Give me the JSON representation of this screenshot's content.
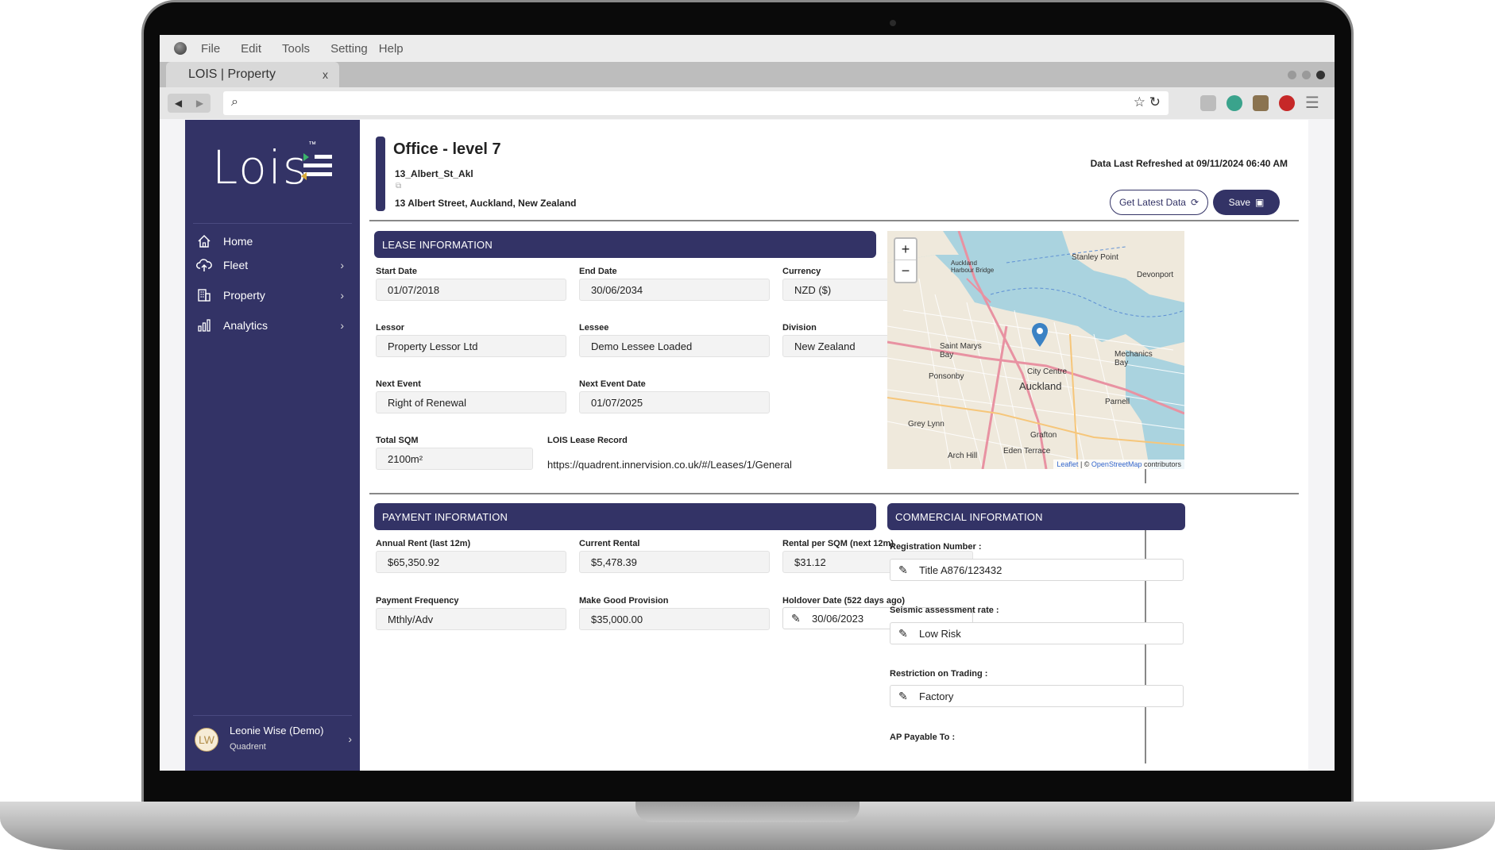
{
  "menu": [
    "File",
    "Edit",
    "Tools",
    "Setting",
    "Help"
  ],
  "tab": {
    "title": "LOIS | Property",
    "close": "x"
  },
  "sidebar": {
    "logo": "Lois",
    "logo_tm": "™",
    "items": [
      {
        "label": "Home",
        "icon": "home-icon"
      },
      {
        "label": "Fleet",
        "icon": "cloud-upload-icon"
      },
      {
        "label": "Property",
        "icon": "building-icon"
      },
      {
        "label": "Analytics",
        "icon": "bar-chart-icon"
      }
    ],
    "user": {
      "initials": "LW",
      "name": "Leonie Wise (Demo)",
      "org": "Quadrent"
    }
  },
  "header": {
    "title": "Office - level 7",
    "code": "13_Albert_St_Akl",
    "address": "13 Albert Street, Auckland, New Zealand",
    "refreshed": "Data Last Refreshed at 09/11/2024 06:40 AM",
    "get_latest_label": "Get Latest Data",
    "save_label": "Save"
  },
  "lease": {
    "heading": "LEASE INFORMATION",
    "start_date": {
      "label": "Start Date",
      "value": "01/07/2018"
    },
    "end_date": {
      "label": "End Date",
      "value": "30/06/2034"
    },
    "currency": {
      "label": "Currency",
      "value": "NZD ($)"
    },
    "lessor": {
      "label": "Lessor",
      "value": "Property Lessor Ltd"
    },
    "lessee": {
      "label": "Lessee",
      "value": "Demo Lessee Loaded"
    },
    "division": {
      "label": "Division",
      "value": "New Zealand"
    },
    "next_event": {
      "label": "Next Event",
      "value": "Right of Renewal"
    },
    "next_event_date": {
      "label": "Next Event Date",
      "value": "01/07/2025"
    },
    "total_sqm": {
      "label": "Total SQM",
      "value": "2100m²"
    },
    "record": {
      "label": "LOIS Lease Record",
      "value": "https://quadrent.innervision.co.uk/#/Leases/1/General"
    }
  },
  "map": {
    "zoom_in": "+",
    "zoom_out": "−",
    "attribution_leaflet": "Leaflet",
    "attribution_osm": "OpenStreetMap",
    "attribution_sep": " | © ",
    "attribution_suffix": " contributors",
    "labels": [
      "Stanley Point",
      "Devonport",
      "Auckland Harbour Bridge",
      "Saint Marys Bay",
      "City Centre",
      "Auckland",
      "Ponsonby",
      "Mechanics Bay",
      "Parnell",
      "Grey Lynn",
      "Grafton",
      "Arch Hill",
      "Eden Terrace"
    ]
  },
  "payment": {
    "heading": "PAYMENT INFORMATION",
    "annual_rent": {
      "label": "Annual Rent (last 12m)",
      "value": "$65,350.92"
    },
    "current_rental": {
      "label": "Current Rental",
      "value": "$5,478.39"
    },
    "rental_sqm": {
      "label": "Rental per SQM (next 12m)",
      "value": "$31.12"
    },
    "frequency": {
      "label": "Payment Frequency",
      "value": "Mthly/Adv"
    },
    "make_good": {
      "label": "Make Good Provision",
      "value": "$35,000.00"
    },
    "holdover": {
      "label": "Holdover Date (522 days ago)",
      "value": "30/06/2023"
    }
  },
  "commercial": {
    "heading": "COMMERCIAL INFORMATION",
    "registration": {
      "label": "Registration Number :",
      "value": "Title A876/123432"
    },
    "seismic": {
      "label": "Seismic assessment rate :",
      "value": "Low Risk"
    },
    "restriction": {
      "label": "Restriction on Trading :",
      "value": "Factory"
    },
    "ap_payable": {
      "label": "AP Payable To :"
    }
  },
  "colors": {
    "brand": "#333366",
    "map_water": "#aad3df",
    "map_land": "#e9e4d6"
  }
}
